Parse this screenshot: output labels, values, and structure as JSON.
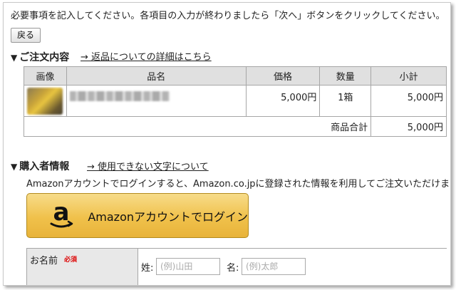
{
  "intro_text": "必要事項を記入してください。各項目の入力が終わりましたら「次へ」ボタンをクリックしてください。",
  "back_button": "戻る",
  "order_section": {
    "marker": "▼",
    "title": "ご注文内容",
    "link": "→ 返品についての詳細はこちら"
  },
  "order_table": {
    "headers": [
      "画像",
      "品名",
      "価格",
      "数量",
      "小計"
    ],
    "rows": [
      {
        "price": "5,000円",
        "quantity": "1箱",
        "subtotal": "5,000円"
      }
    ],
    "total_label": "商品合計",
    "total_value": "5,000円"
  },
  "buyer_section": {
    "marker": "▼",
    "title": "購入者情報",
    "link": "→ 使用できない文字について"
  },
  "amazon_note": "Amazonアカウントでログインすると、Amazon.co.jpに登録された情報を利用してご注文いただけます。",
  "amazon_button": {
    "logo_letter": "a",
    "label": "Amazonアカウントでログイン",
    "color": "#f0c14b"
  },
  "name_field": {
    "label": "お名前",
    "required": "必須",
    "last_name_label": "姓:",
    "last_name_placeholder": "(例)山田",
    "first_name_label": "名:",
    "first_name_placeholder": "(例)太郎"
  }
}
